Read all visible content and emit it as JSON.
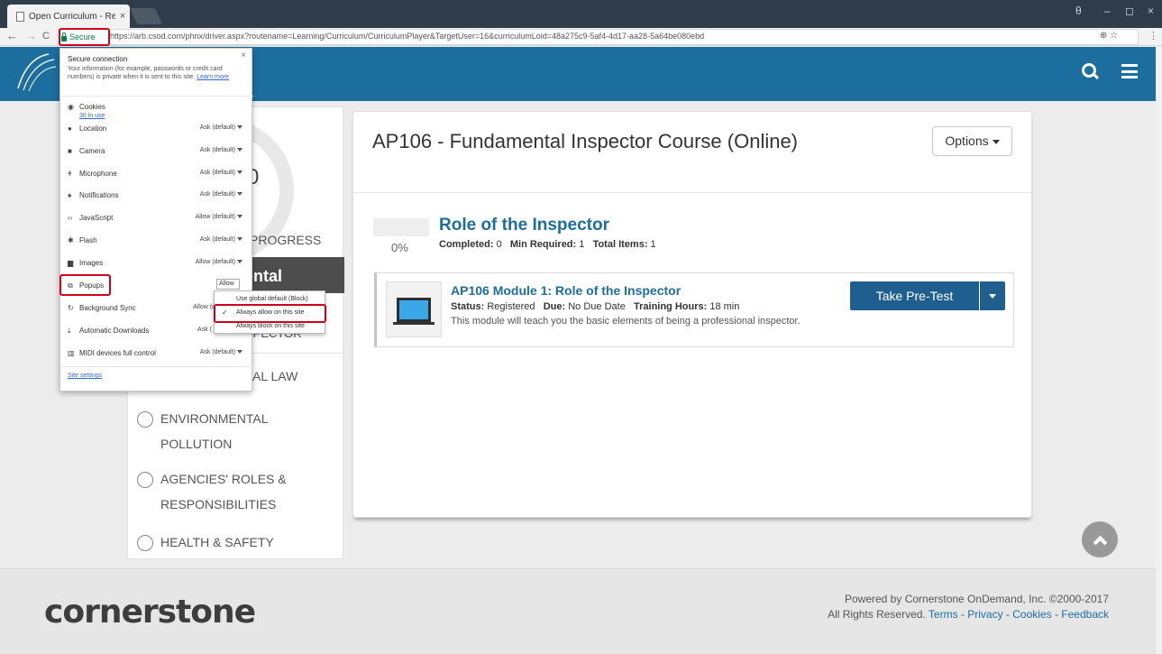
{
  "browser": {
    "tab_title": "Open Curriculum - Realize",
    "tab_close": "×",
    "secure_label": "Secure",
    "url": "https://arb.csod.com/phnx/driver.aspx?routename=Learning/Curriculum/CurriculumPlayer&TargetUser=16&curriculumLoid=48a275c9-5af4-4d17-aa28-5a64be080ebd",
    "nav": {
      "back": "←",
      "forward": "→",
      "reload": "C"
    },
    "omni_icons": "⊕ ☆",
    "menu": "⋮",
    "window": {
      "profile": "θ",
      "minimize": "–",
      "maximize": "◻",
      "close": "×"
    }
  },
  "site_popup": {
    "close": "×",
    "heading": "Secure connection",
    "description": "Your information (for example, passwords or credit card numbers) is private when it is sent to this site.",
    "learn_more": "Learn more",
    "cookies_label": "Cookies",
    "cookies_sub": "30 in use",
    "permissions": [
      {
        "label": "Location",
        "value": "Ask (default)"
      },
      {
        "label": "Camera",
        "value": "Ask (default)"
      },
      {
        "label": "Microphone",
        "value": "Ask (default)"
      },
      {
        "label": "Notifications",
        "value": "Ask (default)"
      },
      {
        "label": "JavaScript",
        "value": "Allow (default)"
      },
      {
        "label": "Flash",
        "value": "Ask (default)"
      },
      {
        "label": "Images",
        "value": "Allow (default)"
      },
      {
        "label": "Popups",
        "value": "Allow"
      },
      {
        "label": "Background Sync",
        "value": "Allow (d"
      },
      {
        "label": "Automatic Downloads",
        "value": "Ask ("
      },
      {
        "label": "MIDI devices full control",
        "value": "Ask (default)"
      }
    ],
    "site_settings": "Site settings",
    "popup_menu": {
      "options": [
        "Use global default (Block)",
        "Always allow on this site",
        "Always block on this site"
      ],
      "check": "✓"
    }
  },
  "curriculum": {
    "progress_value": "0",
    "progress_label": "PROGRESS",
    "active_section": "ental",
    "sub_label": "SPECTOR",
    "law_label": "AL LAW",
    "sections": [
      {
        "label": "ENVIRONMENTAL POLLUTION"
      },
      {
        "label": "AGENCIES' ROLES & RESPONSIBILITIES"
      },
      {
        "label": "HEALTH & SAFETY"
      }
    ]
  },
  "course": {
    "title": "AP106 - Fundamental Inspector Course (Online)",
    "options_label": "Options",
    "lesson": {
      "percent": "0%",
      "title": "Role of the Inspector",
      "completed_label": "Completed:",
      "completed_value": "0",
      "min_required_label": "Min Required:",
      "min_required_value": "1",
      "total_items_label": "Total Items:",
      "total_items_value": "1"
    },
    "module": {
      "title": "AP106 Module 1: Role of the Inspector",
      "status_label": "Status:",
      "status_value": "Registered",
      "due_label": "Due:",
      "due_value": "No Due Date",
      "hours_label": "Training Hours:",
      "hours_value": "18 min",
      "description": "This module will teach you the basic elements of being a professional inspector.",
      "pretest_label": "Take Pre-Test"
    }
  },
  "footer": {
    "brand": "cornerstone",
    "powered_line": "Powered by Cornerstone OnDemand, Inc. ©2000-2017",
    "rights": "All Rights Reserved.",
    "links": [
      "Terms",
      "Privacy",
      "Cookies",
      "Feedback"
    ],
    "link_sep": " - "
  },
  "colors": {
    "brand_blue": "#1c6e9e",
    "button_blue": "#1f5f8f",
    "highlight_red": "#d0021b",
    "secure_green": "#0b8043"
  }
}
